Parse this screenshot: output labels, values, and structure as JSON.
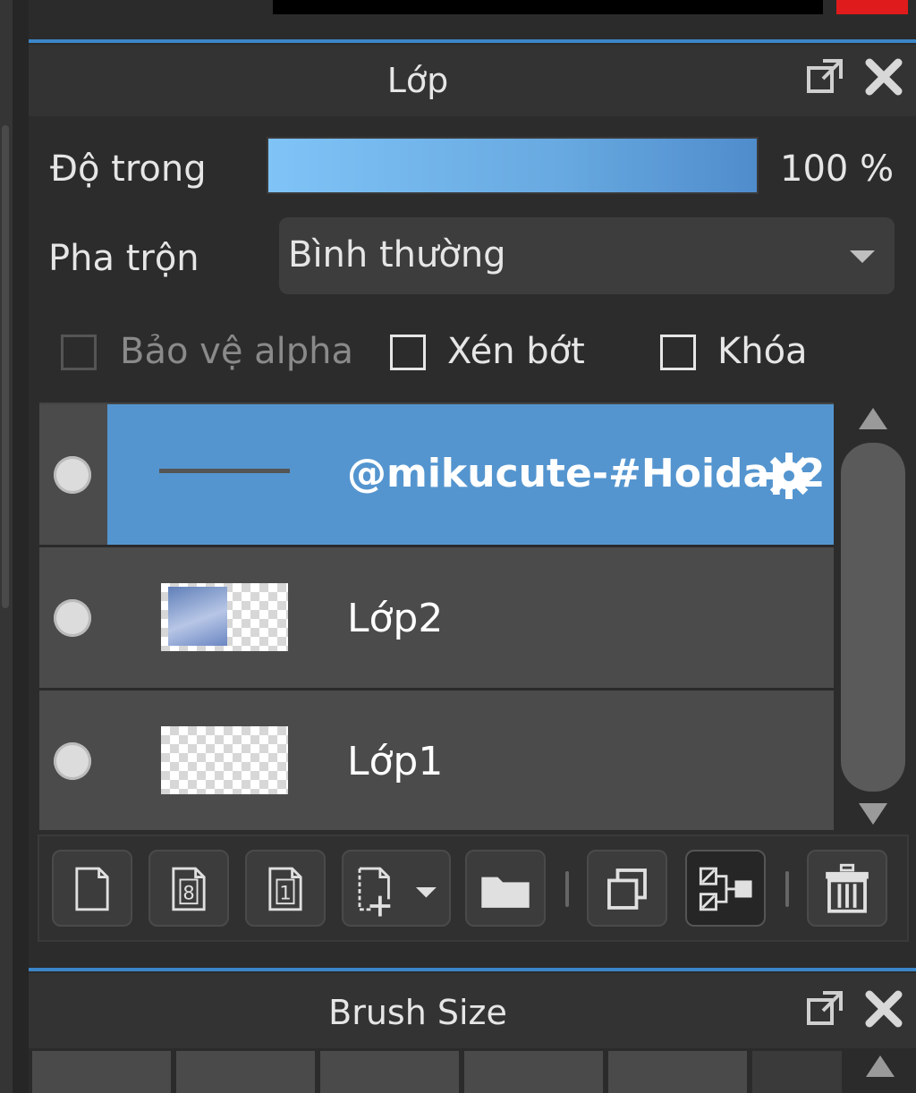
{
  "window": {
    "accent_color": "#3b86c8",
    "selected_color": "#5495cf"
  },
  "layers_panel": {
    "title": "Lớp",
    "popout_icon": "popout-icon",
    "close_icon": "close-icon",
    "opacity": {
      "label": "Độ trong",
      "value_text": "100 %",
      "value": 100
    },
    "blend": {
      "label": "Pha trộn",
      "selected": "Bình thường"
    },
    "checkboxes": {
      "protect_alpha": {
        "label": "Bảo vệ alpha",
        "checked": false,
        "enabled": false
      },
      "clipping": {
        "label": "Xén bớt",
        "checked": false,
        "enabled": true
      },
      "lock": {
        "label": "Khóa",
        "checked": false,
        "enabled": true
      }
    },
    "layers": [
      {
        "name": "@mikucute-#Hoidap2",
        "selected": true,
        "visible": true
      },
      {
        "name": "Lớp2",
        "selected": false,
        "visible": true
      },
      {
        "name": "Lớp1",
        "selected": false,
        "visible": true
      }
    ],
    "toolbar": [
      "new-layer-icon",
      "new-8bit-layer-icon",
      "new-1bit-layer-icon",
      "add-layer-dropdown-icon",
      "new-folder-icon",
      "duplicate-layer-icon",
      "merge-down-icon",
      "delete-layer-icon"
    ]
  },
  "brush_panel": {
    "title": "Brush Size"
  }
}
